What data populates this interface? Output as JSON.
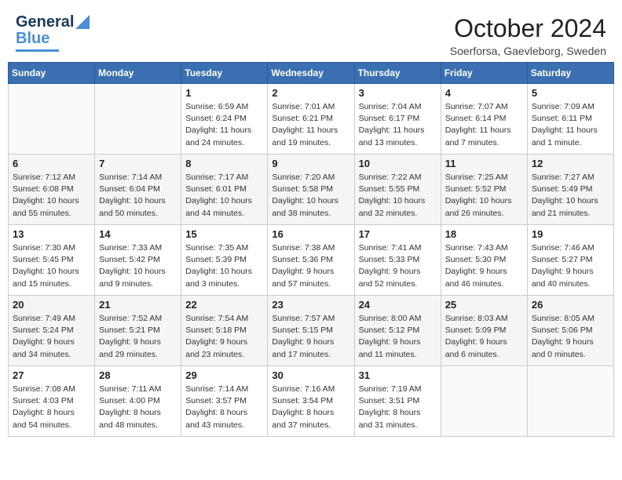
{
  "header": {
    "logo": {
      "line1": "General",
      "line2": "Blue"
    },
    "title": "October 2024",
    "subtitle": "Soerforsa, Gaevleborg, Sweden"
  },
  "weekdays": [
    "Sunday",
    "Monday",
    "Tuesday",
    "Wednesday",
    "Thursday",
    "Friday",
    "Saturday"
  ],
  "weeks": [
    [
      {
        "day": "",
        "sunrise": "",
        "sunset": "",
        "daylight": ""
      },
      {
        "day": "",
        "sunrise": "",
        "sunset": "",
        "daylight": ""
      },
      {
        "day": "1",
        "sunrise": "Sunrise: 6:59 AM",
        "sunset": "Sunset: 6:24 PM",
        "daylight": "Daylight: 11 hours and 24 minutes."
      },
      {
        "day": "2",
        "sunrise": "Sunrise: 7:01 AM",
        "sunset": "Sunset: 6:21 PM",
        "daylight": "Daylight: 11 hours and 19 minutes."
      },
      {
        "day": "3",
        "sunrise": "Sunrise: 7:04 AM",
        "sunset": "Sunset: 6:17 PM",
        "daylight": "Daylight: 11 hours and 13 minutes."
      },
      {
        "day": "4",
        "sunrise": "Sunrise: 7:07 AM",
        "sunset": "Sunset: 6:14 PM",
        "daylight": "Daylight: 11 hours and 7 minutes."
      },
      {
        "day": "5",
        "sunrise": "Sunrise: 7:09 AM",
        "sunset": "Sunset: 6:11 PM",
        "daylight": "Daylight: 11 hours and 1 minute."
      }
    ],
    [
      {
        "day": "6",
        "sunrise": "Sunrise: 7:12 AM",
        "sunset": "Sunset: 6:08 PM",
        "daylight": "Daylight: 10 hours and 55 minutes."
      },
      {
        "day": "7",
        "sunrise": "Sunrise: 7:14 AM",
        "sunset": "Sunset: 6:04 PM",
        "daylight": "Daylight: 10 hours and 50 minutes."
      },
      {
        "day": "8",
        "sunrise": "Sunrise: 7:17 AM",
        "sunset": "Sunset: 6:01 PM",
        "daylight": "Daylight: 10 hours and 44 minutes."
      },
      {
        "day": "9",
        "sunrise": "Sunrise: 7:20 AM",
        "sunset": "Sunset: 5:58 PM",
        "daylight": "Daylight: 10 hours and 38 minutes."
      },
      {
        "day": "10",
        "sunrise": "Sunrise: 7:22 AM",
        "sunset": "Sunset: 5:55 PM",
        "daylight": "Daylight: 10 hours and 32 minutes."
      },
      {
        "day": "11",
        "sunrise": "Sunrise: 7:25 AM",
        "sunset": "Sunset: 5:52 PM",
        "daylight": "Daylight: 10 hours and 26 minutes."
      },
      {
        "day": "12",
        "sunrise": "Sunrise: 7:27 AM",
        "sunset": "Sunset: 5:49 PM",
        "daylight": "Daylight: 10 hours and 21 minutes."
      }
    ],
    [
      {
        "day": "13",
        "sunrise": "Sunrise: 7:30 AM",
        "sunset": "Sunset: 5:45 PM",
        "daylight": "Daylight: 10 hours and 15 minutes."
      },
      {
        "day": "14",
        "sunrise": "Sunrise: 7:33 AM",
        "sunset": "Sunset: 5:42 PM",
        "daylight": "Daylight: 10 hours and 9 minutes."
      },
      {
        "day": "15",
        "sunrise": "Sunrise: 7:35 AM",
        "sunset": "Sunset: 5:39 PM",
        "daylight": "Daylight: 10 hours and 3 minutes."
      },
      {
        "day": "16",
        "sunrise": "Sunrise: 7:38 AM",
        "sunset": "Sunset: 5:36 PM",
        "daylight": "Daylight: 9 hours and 57 minutes."
      },
      {
        "day": "17",
        "sunrise": "Sunrise: 7:41 AM",
        "sunset": "Sunset: 5:33 PM",
        "daylight": "Daylight: 9 hours and 52 minutes."
      },
      {
        "day": "18",
        "sunrise": "Sunrise: 7:43 AM",
        "sunset": "Sunset: 5:30 PM",
        "daylight": "Daylight: 9 hours and 46 minutes."
      },
      {
        "day": "19",
        "sunrise": "Sunrise: 7:46 AM",
        "sunset": "Sunset: 5:27 PM",
        "daylight": "Daylight: 9 hours and 40 minutes."
      }
    ],
    [
      {
        "day": "20",
        "sunrise": "Sunrise: 7:49 AM",
        "sunset": "Sunset: 5:24 PM",
        "daylight": "Daylight: 9 hours and 34 minutes."
      },
      {
        "day": "21",
        "sunrise": "Sunrise: 7:52 AM",
        "sunset": "Sunset: 5:21 PM",
        "daylight": "Daylight: 9 hours and 29 minutes."
      },
      {
        "day": "22",
        "sunrise": "Sunrise: 7:54 AM",
        "sunset": "Sunset: 5:18 PM",
        "daylight": "Daylight: 9 hours and 23 minutes."
      },
      {
        "day": "23",
        "sunrise": "Sunrise: 7:57 AM",
        "sunset": "Sunset: 5:15 PM",
        "daylight": "Daylight: 9 hours and 17 minutes."
      },
      {
        "day": "24",
        "sunrise": "Sunrise: 8:00 AM",
        "sunset": "Sunset: 5:12 PM",
        "daylight": "Daylight: 9 hours and 11 minutes."
      },
      {
        "day": "25",
        "sunrise": "Sunrise: 8:03 AM",
        "sunset": "Sunset: 5:09 PM",
        "daylight": "Daylight: 9 hours and 6 minutes."
      },
      {
        "day": "26",
        "sunrise": "Sunrise: 8:05 AM",
        "sunset": "Sunset: 5:06 PM",
        "daylight": "Daylight: 9 hours and 0 minutes."
      }
    ],
    [
      {
        "day": "27",
        "sunrise": "Sunrise: 7:08 AM",
        "sunset": "Sunset: 4:03 PM",
        "daylight": "Daylight: 8 hours and 54 minutes."
      },
      {
        "day": "28",
        "sunrise": "Sunrise: 7:11 AM",
        "sunset": "Sunset: 4:00 PM",
        "daylight": "Daylight: 8 hours and 48 minutes."
      },
      {
        "day": "29",
        "sunrise": "Sunrise: 7:14 AM",
        "sunset": "Sunset: 3:57 PM",
        "daylight": "Daylight: 8 hours and 43 minutes."
      },
      {
        "day": "30",
        "sunrise": "Sunrise: 7:16 AM",
        "sunset": "Sunset: 3:54 PM",
        "daylight": "Daylight: 8 hours and 37 minutes."
      },
      {
        "day": "31",
        "sunrise": "Sunrise: 7:19 AM",
        "sunset": "Sunset: 3:51 PM",
        "daylight": "Daylight: 8 hours and 31 minutes."
      },
      {
        "day": "",
        "sunrise": "",
        "sunset": "",
        "daylight": ""
      },
      {
        "day": "",
        "sunrise": "",
        "sunset": "",
        "daylight": ""
      }
    ]
  ]
}
